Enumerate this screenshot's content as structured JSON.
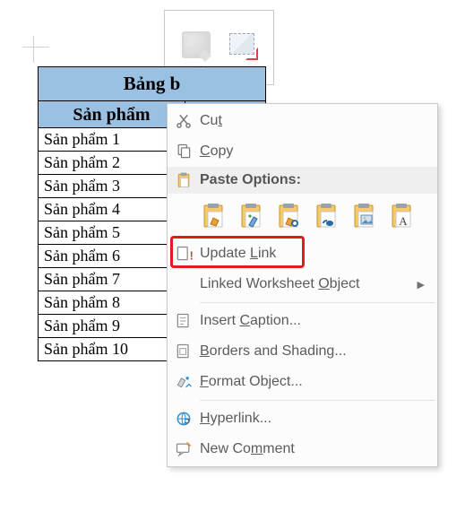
{
  "mini_toolbar": {
    "style_label": "Style",
    "crop_label": "Crop"
  },
  "table": {
    "title": "Bảng b",
    "col1_header": "Sản phẩm",
    "col2_header": "",
    "rows": [
      "Sản phẩm 1",
      "Sản phẩm 2",
      "Sản phẩm 3",
      "Sản phẩm 4",
      "Sản phẩm 5",
      "Sản phẩm 6",
      "Sản phẩm 7",
      "Sản phẩm 8",
      "Sản phẩm 9",
      "Sản phẩm 10"
    ]
  },
  "context_menu": {
    "cut": "Cut",
    "copy": "Copy",
    "paste_options": "Paste Options:",
    "update_link": "Update Link",
    "linked_worksheet_object": "Linked Worksheet Object",
    "insert_caption": "Insert Caption...",
    "borders_and_shading": "Borders and Shading...",
    "format_object": "Format Object...",
    "hyperlink": "Hyperlink...",
    "new_comment": "New Comment"
  },
  "highlighted_item": "update_link"
}
